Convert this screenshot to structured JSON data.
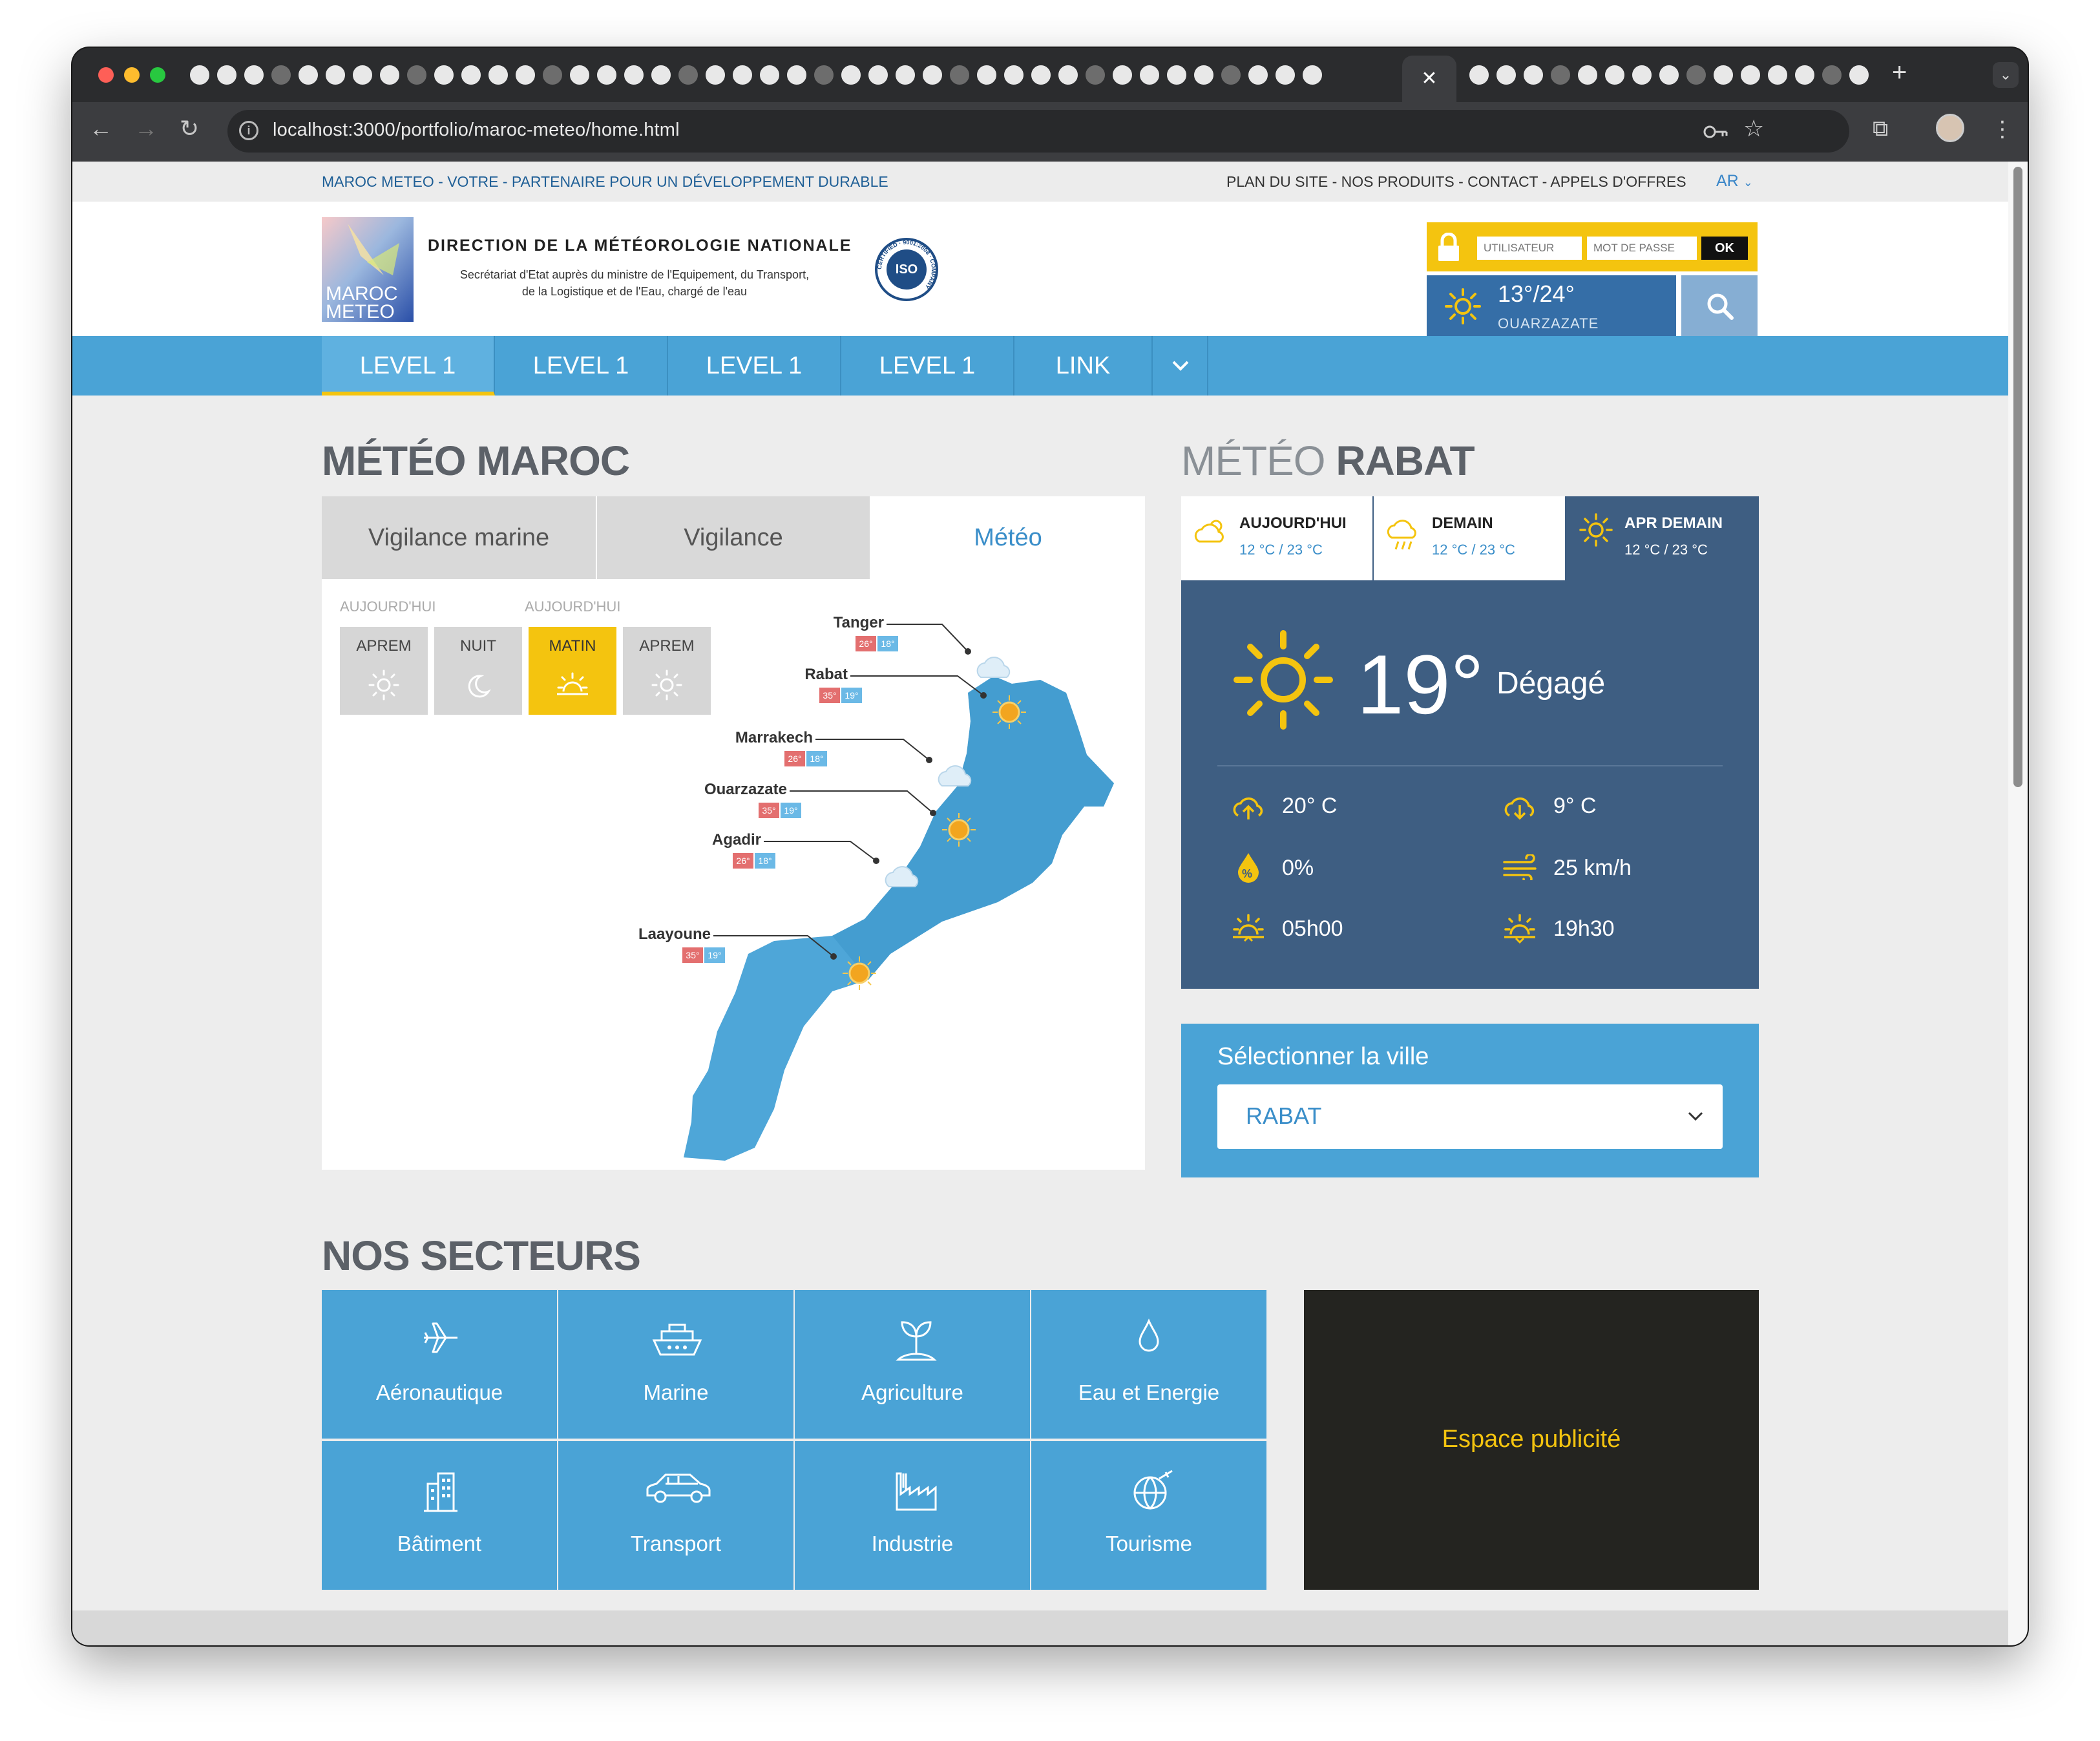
{
  "browser": {
    "url": "localhost:3000/portfolio/maroc-meteo/home.html",
    "active_tab_close": "✕",
    "new_tab": "+"
  },
  "topbar": {
    "tagline": "MAROC METEO - VOTRE - PARTENAIRE POUR UN DÉVELOPPEMENT DURABLE",
    "links": "PLAN DU SITE - NOS PRODUITS - CONTACT - APPELS D'OFFRES",
    "lang": "AR"
  },
  "header": {
    "logo_text_1": "MAROC",
    "logo_text_2": "METEO",
    "org_title": "DIRECTION DE LA MÉTÉOROLOGIE NATIONALE",
    "org_sub_1": "Secrétariat d'Etat auprès du ministre de l'Equipement, du Transport,",
    "org_sub_2": "de la Logistique et de l'Eau, chargé de l'eau",
    "iso_label": "ISO",
    "iso_ring": "CERTIFIED · 9001:2008 · COMPANY",
    "login": {
      "user_placeholder": "UTILISATEUR",
      "pass_placeholder": "MOT DE PASSE",
      "ok": "OK"
    },
    "weather": {
      "temp": "13°/24°",
      "city": "OUARZAZATE"
    }
  },
  "nav": {
    "items": [
      "LEVEL 1",
      "LEVEL 1",
      "LEVEL 1",
      "LEVEL 1",
      "LINK"
    ]
  },
  "meteo_maroc": {
    "title": "MÉTÉO MAROC",
    "tabs": [
      "Vigilance marine",
      "Vigilance",
      "Météo"
    ],
    "active_tab": 2,
    "day_labels": [
      "AUJOURD'HUI",
      "AUJOURD'HUI"
    ],
    "periods": [
      "APREM",
      "NUIT",
      "MATIN",
      "APREM"
    ],
    "active_period": 2,
    "cities": [
      {
        "name": "Tanger",
        "max": "26°",
        "min": "18°"
      },
      {
        "name": "Rabat",
        "max": "35°",
        "min": "19°"
      },
      {
        "name": "Marrakech",
        "max": "26°",
        "min": "18°"
      },
      {
        "name": "Ouarzazate",
        "max": "35°",
        "min": "19°"
      },
      {
        "name": "Agadir",
        "max": "26°",
        "min": "18°"
      },
      {
        "name": "Laayoune",
        "max": "35°",
        "min": "19°"
      }
    ]
  },
  "meteo_rabat": {
    "title_light": "MÉTÉO ",
    "title_bold": "RABAT",
    "days": [
      {
        "label": "AUJOURD'HUI",
        "range": "12 °C / 23 °C"
      },
      {
        "label": "DEMAIN",
        "range": "12 °C / 23 °C"
      },
      {
        "label": "APR DEMAIN",
        "range": "12 °C / 23 °C"
      }
    ],
    "active_day": 2,
    "temp": "19°",
    "condition": "Dégagé",
    "stats": {
      "max": "20° C",
      "min": "9° C",
      "humidity": "0%",
      "wind": "25 km/h",
      "sunrise": "05h00",
      "sunset": "19h30"
    },
    "city_select_label": "Sélectionner la ville",
    "city_selected": "RABAT"
  },
  "secteurs": {
    "title": "NOS SECTEURS",
    "items": [
      "Aéronautique",
      "Marine",
      "Agriculture",
      "Eau et Energie",
      "Bâtiment",
      "Transport",
      "Industrie",
      "Tourisme"
    ],
    "ad": "Espace publicité"
  },
  "colors": {
    "accent_blue": "#4aa3d6",
    "navy": "#3e5e82",
    "yellow": "#f4c40f",
    "dark": "#242420"
  }
}
